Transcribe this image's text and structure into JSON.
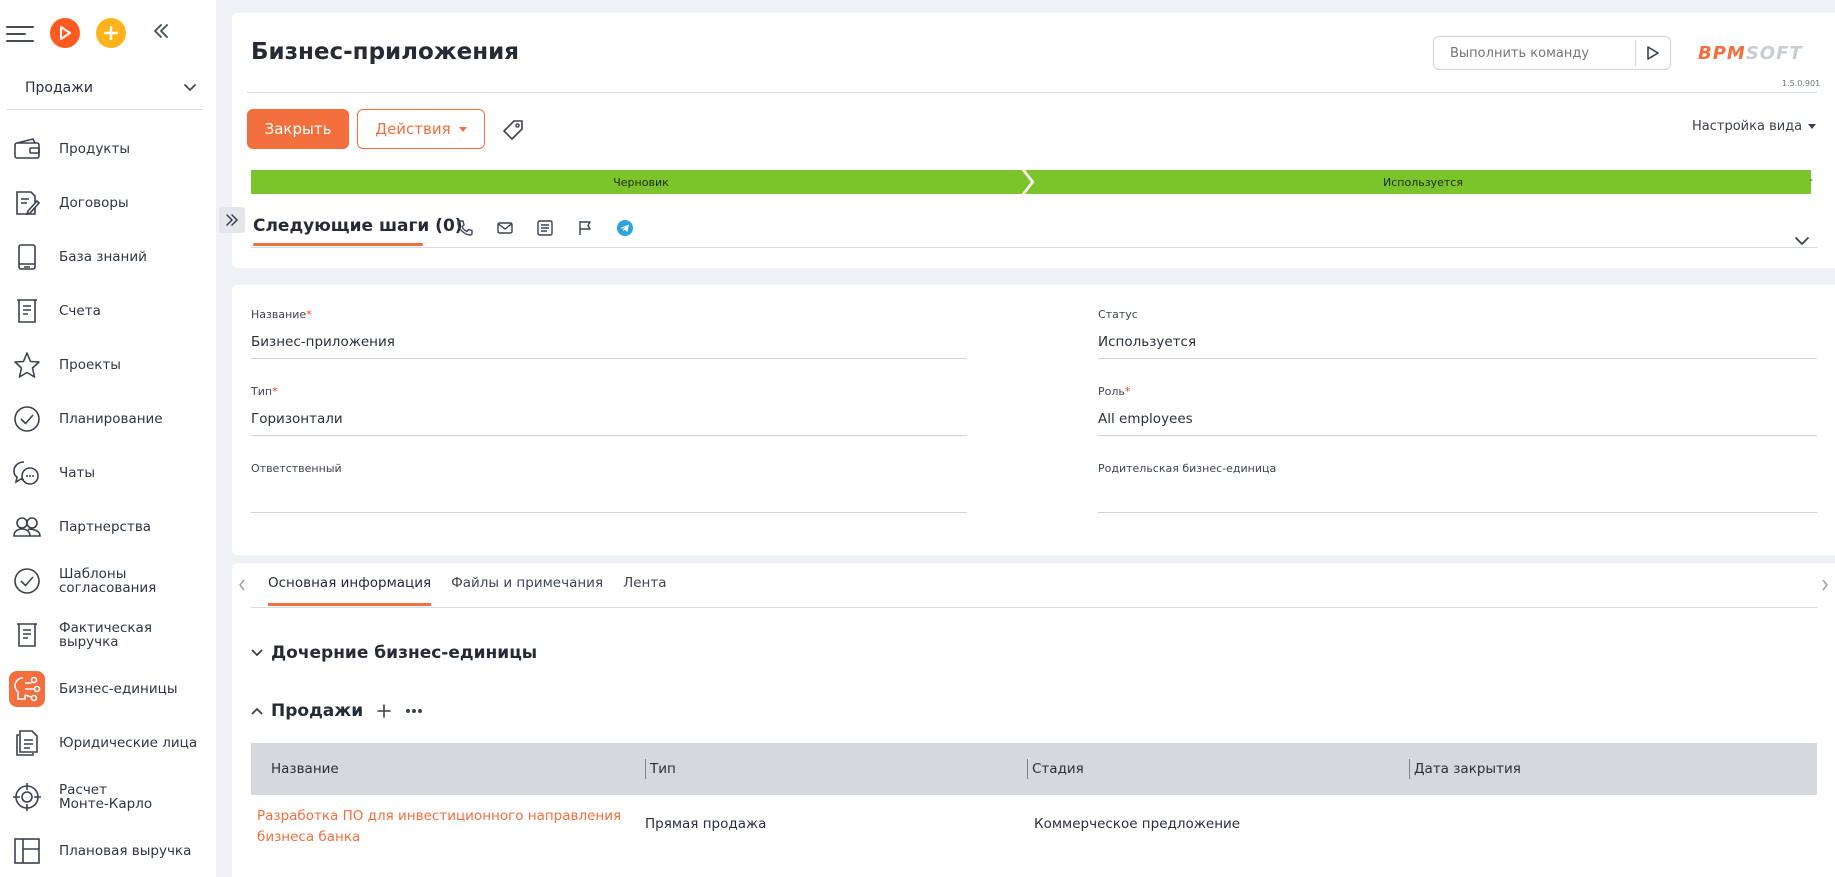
{
  "sidebar": {
    "workspace": "Продажи",
    "items": [
      {
        "label": "Продукты",
        "icon": "wallet-icon"
      },
      {
        "label": "Договоры",
        "icon": "contract-icon"
      },
      {
        "label": "База знаний",
        "icon": "book-icon"
      },
      {
        "label": "Счета",
        "icon": "receipt-icon"
      },
      {
        "label": "Проекты",
        "icon": "star-icon"
      },
      {
        "label": "Планирование",
        "icon": "check-circle-icon"
      },
      {
        "label": "Чаты",
        "icon": "chat-icon"
      },
      {
        "label": "Партнерства",
        "icon": "users-icon"
      },
      {
        "label": "Шаблоны согласования",
        "icon": "check-circle-icon"
      },
      {
        "label": "Фактическая выручка",
        "icon": "receipt-icon"
      },
      {
        "label": "Бизнес-единицы",
        "icon": "network-icon",
        "active": true
      },
      {
        "label": "Юридические лица",
        "icon": "documents-icon"
      },
      {
        "label": "Расчет Монте-Карло",
        "icon": "target-icon"
      },
      {
        "label": "Плановая выручка",
        "icon": "layout-icon"
      }
    ]
  },
  "header": {
    "title": "Бизнес-приложения",
    "command_placeholder": "Выполнить команду",
    "logo_bpm": "BPM",
    "logo_soft": "SOFT",
    "version": "1.5.0.901",
    "close_label": "Закрыть",
    "actions_label": "Действия",
    "view_settings": "Настройка вида"
  },
  "stages": {
    "first": "Черновик",
    "second": "Используется",
    "end": "-"
  },
  "next_steps": {
    "title": "Следующие шаги (0)"
  },
  "form": {
    "name_label": "Название",
    "name_value": "Бизнес-приложения",
    "status_label": "Статус",
    "status_value": "Используется",
    "type_label": "Тип",
    "type_value": "Горизонтали",
    "role_label": "Роль",
    "role_value": "All employees",
    "owner_label": "Ответственный",
    "owner_value": "",
    "parent_label": "Родительская бизнес-единица",
    "parent_value": "",
    "required_mark": "*"
  },
  "tabs": [
    "Основная информация",
    "Файлы и примечания",
    "Лента"
  ],
  "sections": {
    "child_units": "Дочерние бизнес-единицы",
    "sales": "Продажи"
  },
  "sales_grid": {
    "columns": [
      "Название",
      "Тип",
      "Стадия",
      "Дата закрытия"
    ],
    "rows": [
      {
        "name": "Разработка ПО для инвестиционного направления бизнеса банка",
        "type": "Прямая продажа",
        "stage": "Коммерческое предложение",
        "close_date": ""
      }
    ]
  },
  "colors": {
    "accent": "#f36f3d",
    "stage_green": "#7bc42c",
    "grid_header": "#d6d8de"
  }
}
